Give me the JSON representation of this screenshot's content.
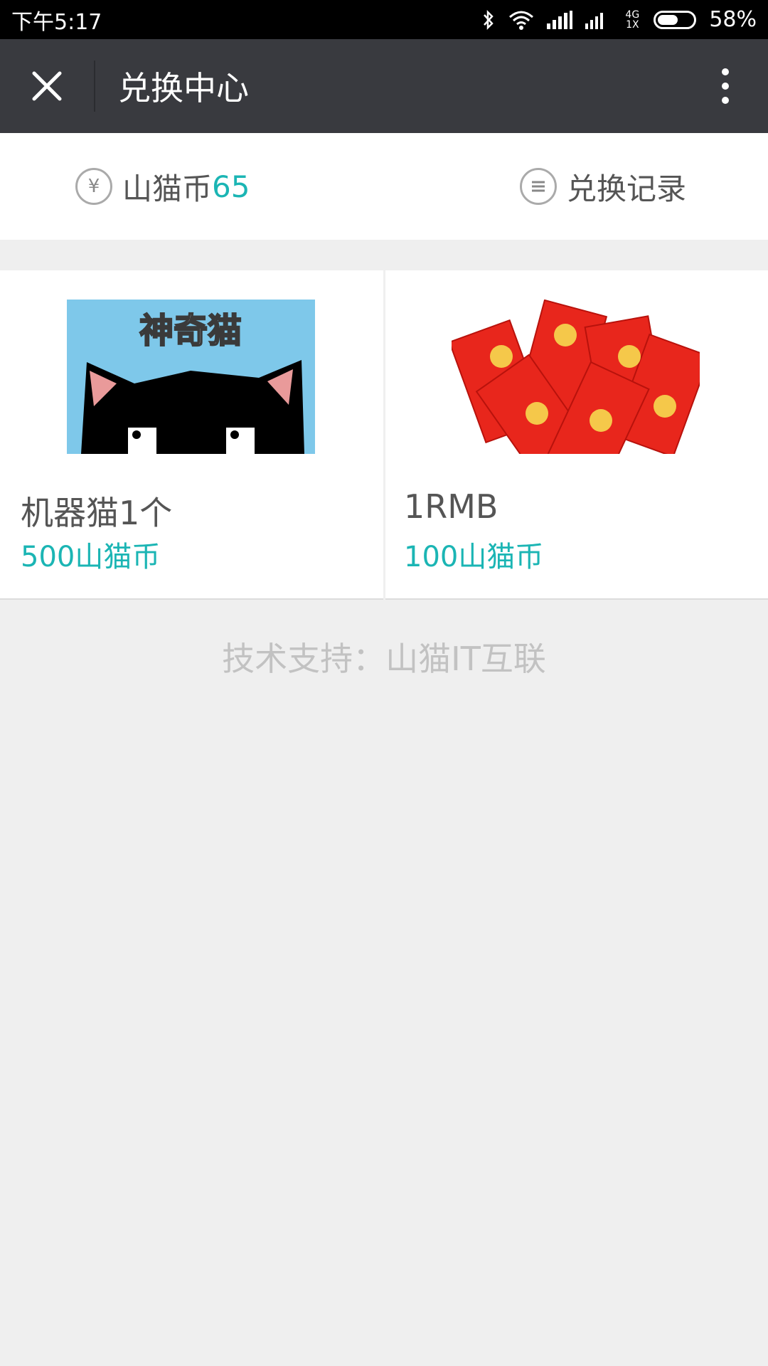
{
  "status_bar": {
    "time": "下午5:17",
    "network_label": "4G 1X",
    "battery": "58%"
  },
  "header": {
    "title": "兑换中心"
  },
  "wallet": {
    "currency_icon": "yen-icon",
    "label": "山猫币",
    "balance": "65",
    "history_icon": "list-icon",
    "history_label": "兑换记录"
  },
  "items": [
    {
      "image_text": "神奇猫",
      "name": "机器猫1个",
      "price": "500山猫币"
    },
    {
      "name": "1RMB",
      "price": "100山猫币"
    }
  ],
  "footer": {
    "text": "技术支持：山猫IT互联"
  },
  "colors": {
    "accent": "#1bb5b4",
    "titlebar": "#393a3f",
    "background": "#efefef"
  }
}
